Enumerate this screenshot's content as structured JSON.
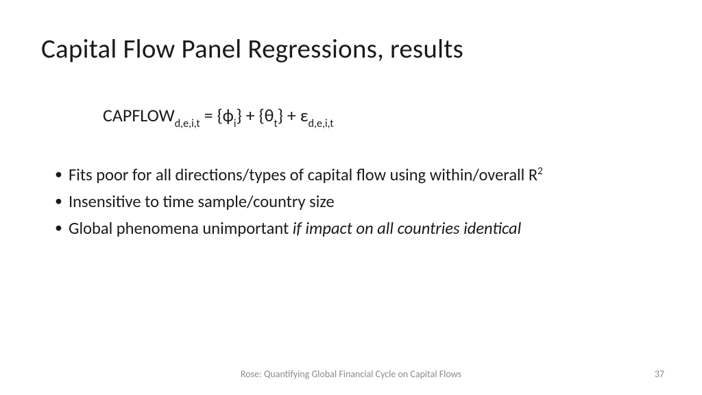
{
  "title": "Capital Flow Panel Regressions, results",
  "equation": {
    "lhs_name": "CAPFLOW",
    "lhs_sub": "d,e,i,t",
    "eq": " = ",
    "term1_open": "{",
    "term1_sym": "ф",
    "term1_sub": "i",
    "term1_close": "}",
    "plus1": " + ",
    "term2_open": "{",
    "term2_sym": "θ",
    "term2_sub": "t",
    "term2_close": "}",
    "plus2": " + ",
    "eps": "ε",
    "eps_sub": "d,e,i,t"
  },
  "bullets": [
    {
      "pre": "Fits poor for all directions/types of capital flow using within/overall R",
      "sup": "2",
      "post": ""
    },
    {
      "pre": "Insensitive to time sample/country size",
      "sup": "",
      "post": ""
    },
    {
      "pre": "Global phenomena unimportant ",
      "italic": "if impact on all countries identical",
      "sup": "",
      "post": ""
    }
  ],
  "footer": {
    "center": "Rose: Quantifying Global Financial Cycle on Capital Flows",
    "page": "37"
  }
}
